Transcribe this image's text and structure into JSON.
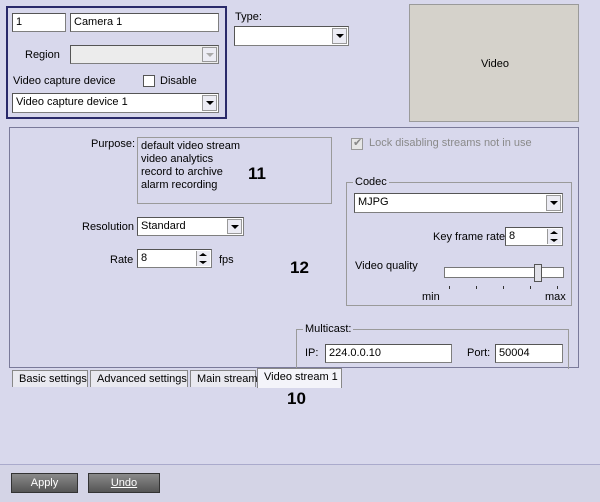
{
  "camera": {
    "id": "1",
    "name": "Camera 1"
  },
  "region": {
    "label": "Region",
    "value": ""
  },
  "video_capture": {
    "label": "Video capture device",
    "disable_label": "Disable",
    "device": "Video capture device 1"
  },
  "type": {
    "label": "Type:",
    "value": ""
  },
  "video_preview": {
    "label": "Video"
  },
  "purpose": {
    "label": "Purpose:",
    "items": [
      "default video stream",
      "video analytics",
      "record to archive",
      "alarm recording"
    ]
  },
  "resolution": {
    "label": "Resolution",
    "value": "Standard"
  },
  "rate": {
    "label": "Rate",
    "value": "8",
    "unit": "fps"
  },
  "lock_streams": {
    "label": "Lock disabling streams not in use",
    "checked": true
  },
  "codec": {
    "group_label": "Codec",
    "value": "MJPG",
    "key_frame_label": "Key frame rate",
    "key_frame_value": "8",
    "video_quality_label": "Video quality",
    "quality_min": "min",
    "quality_max": "max",
    "quality_level": 0.8
  },
  "multicast": {
    "group_label": "Multicast:",
    "ip_label": "IP:",
    "ip_value": "224.0.0.10",
    "port_label": "Port:",
    "port_value": "50004"
  },
  "callouts": {
    "c10": "10",
    "c11": "11",
    "c12": "12"
  },
  "tabs": [
    "Basic settings",
    "Advanced settings",
    "Main stream",
    "Video stream 1"
  ],
  "buttons": {
    "apply": "Apply",
    "undo": "Undo"
  }
}
